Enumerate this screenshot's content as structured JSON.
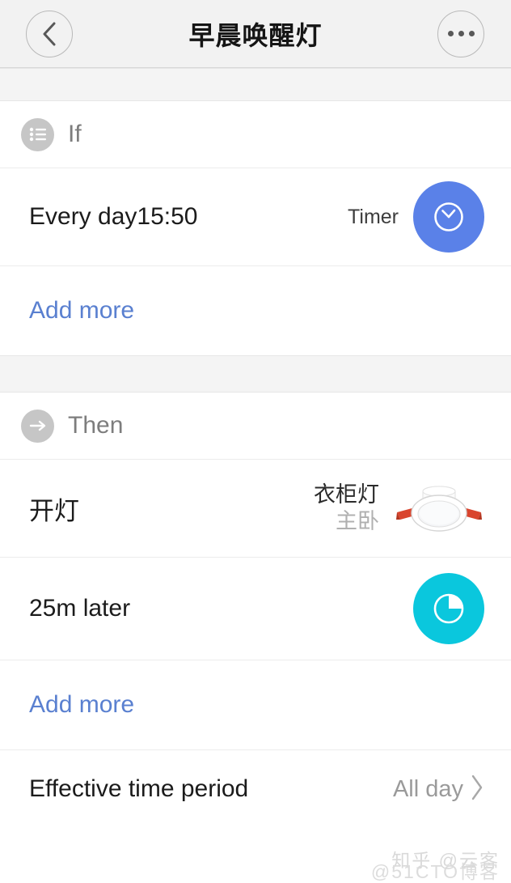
{
  "header": {
    "title": "早晨唤醒灯",
    "back_icon": "chevron-left-icon",
    "more_icon": "ellipsis-icon"
  },
  "if_section": {
    "label": "If",
    "icon": "list-icon",
    "rows": [
      {
        "title": "Every day15:50",
        "meta": "Timer",
        "badge_icon": "clock-icon",
        "badge_color": "#5a81e8"
      }
    ],
    "add_more": "Add more"
  },
  "then_section": {
    "label": "Then",
    "icon": "arrow-right-icon",
    "rows": [
      {
        "title": "开灯",
        "device_name": "衣柜灯",
        "device_room": "主卧",
        "thumbnail": "downlight-icon"
      },
      {
        "title": "25m later",
        "badge_icon": "delay-timer-icon",
        "badge_color": "#0ac7dd"
      }
    ],
    "add_more": "Add more"
  },
  "effective": {
    "label": "Effective time period",
    "value": "All day",
    "chevron_icon": "chevron-right-icon"
  },
  "watermark": {
    "line1": "知乎 @云客",
    "line2": "@51CTO博客"
  },
  "colors": {
    "accent_blue": "#5a80d0",
    "timer_blue": "#5a81e8",
    "delay_cyan": "#0ac7dd",
    "page_bg": "#ffffff",
    "band_bg": "#f4f4f4",
    "header_bg": "#f2f2f2"
  }
}
